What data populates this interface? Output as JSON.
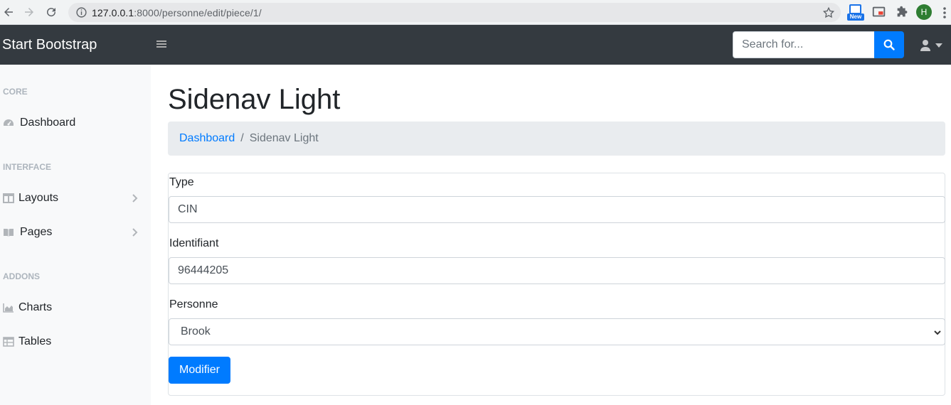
{
  "browser": {
    "url_host": "127.0.0.1",
    "url_rest": ":8000/personne/edit/piece/1/",
    "ext_badge": "New",
    "profile_initial": "H"
  },
  "navbar": {
    "brand": "Start Bootstrap",
    "search_placeholder": "Search for...",
    "search_value": ""
  },
  "sidebar": {
    "sections": [
      {
        "heading": "CORE"
      },
      {
        "heading": "INTERFACE"
      },
      {
        "heading": "ADDONS"
      }
    ],
    "items": [
      {
        "label": "Dashboard",
        "icon": "tachometer-icon"
      },
      {
        "label": "Layouts",
        "icon": "columns-icon"
      },
      {
        "label": "Pages",
        "icon": "book-open-icon"
      },
      {
        "label": "Charts",
        "icon": "area-chart-icon"
      },
      {
        "label": "Tables",
        "icon": "table-icon"
      }
    ]
  },
  "page": {
    "title": "Sidenav Light",
    "breadcrumb": {
      "link": "Dashboard",
      "separator": "/",
      "active": "Sidenav Light"
    }
  },
  "form": {
    "type_label": "Type",
    "type_value": "CIN",
    "id_label": "Identifiant",
    "id_value": "96444205",
    "personne_label": "Personne",
    "personne_value": "Brook",
    "submit_label": "Modifier"
  },
  "colors": {
    "navbar_bg": "#343a40",
    "primary": "#007bff",
    "sidebar_bg": "#f8f9fa"
  }
}
